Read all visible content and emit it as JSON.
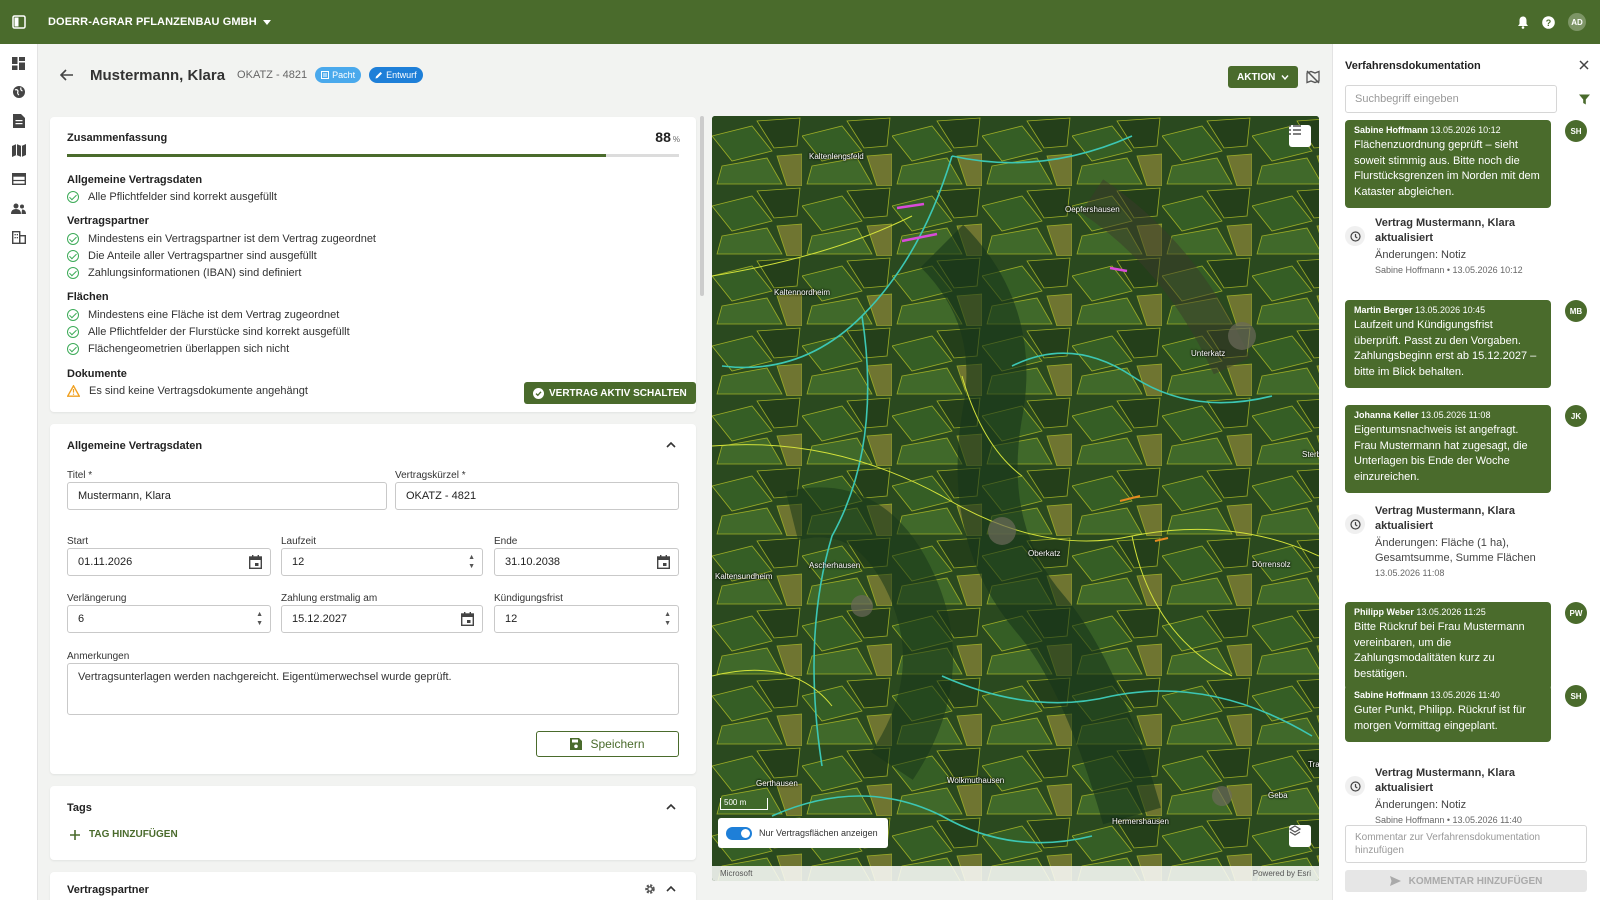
{
  "topbar": {
    "company": "DOERR-AGRAR PFLANZENBAU GMBH",
    "user_initials": "AD"
  },
  "header": {
    "title": "Mustermann, Klara",
    "code": "OKATZ - 4821",
    "chip_pacht": "Pacht",
    "chip_entwurf": "Entwurf",
    "action_label": "AKTION"
  },
  "summary": {
    "title": "Zusammenfassung",
    "percent": "88",
    "percent_unit": "%",
    "progress_value": 0.88,
    "sections": [
      {
        "title": "Allgemeine Vertragsdaten",
        "items": [
          "Alle Pflichtfelder sind korrekt ausgefüllt"
        ]
      },
      {
        "title": "Vertragspartner",
        "items": [
          "Mindestens ein Vertragspartner ist dem Vertrag zugeordnet",
          "Die Anteile aller Vertragspartner sind ausgefüllt",
          "Zahlungsinformationen (IBAN) sind definiert"
        ]
      },
      {
        "title": "Flächen",
        "items": [
          "Mindestens eine Fläche ist dem Vertrag zugeordnet",
          "Alle Pflichtfelder der Flurstücke sind korrekt ausgefüllt",
          "Flächengeometrien überlappen sich nicht"
        ]
      },
      {
        "title": "Dokumente",
        "items": [
          "Es sind keine Vertragsdokumente angehängt"
        ]
      }
    ],
    "activate_label": "VERTRAG AKTIV SCHALTEN"
  },
  "form": {
    "title": "Allgemeine Vertragsdaten",
    "titel_label": "Titel *",
    "titel_value": "Mustermann, Klara",
    "kuerzel_label": "Vertragskürzel *",
    "kuerzel_value": "OKATZ - 4821",
    "start_label": "Start",
    "start_value": "01.11.2026",
    "laufzeit_label": "Laufzeit",
    "laufzeit_value": "12",
    "ende_label": "Ende",
    "ende_value": "31.10.2038",
    "verl_label": "Verlängerung",
    "verl_value": "6",
    "zahlung_label": "Zahlung erstmalig am",
    "zahlung_value": "15.12.2027",
    "kuend_label": "Kündigungsfrist",
    "kuend_value": "12",
    "anm_label": "Anmerkungen",
    "anm_value": "Vertragsunterlagen werden nachgereicht. Eigentümerwechsel wurde geprüft.",
    "save_label": "Speichern"
  },
  "tags": {
    "title": "Tags",
    "add_label": "TAG HINZUFÜGEN"
  },
  "partner": {
    "title": "Vertragspartner"
  },
  "map": {
    "places": [
      "Kaltenlengsfeld",
      "Oepfershausen",
      "Kaltennordheim",
      "Unterkatz",
      "Sterb",
      "Oberkatz",
      "Dörrensolz",
      "Ascherhausen",
      "Kaltensundheim",
      "Gerthausen",
      "Wolkmuthausen",
      "Geba",
      "Hermershausen",
      "Tra"
    ],
    "scale": "500 m",
    "toggle_label": "Nur Vertragsflächen anzeigen",
    "credit_left": "Microsoft",
    "credit_right": "Powered by Esri"
  },
  "panel": {
    "title": "Verfahrensdokumentation",
    "search_placeholder": "Suchbegriff eingeben",
    "messages": [
      {
        "author": "Sabine Hoffmann",
        "time": "13.05.2026 10:12",
        "text": "Flächenzuordnung geprüft – sieht soweit stimmig aus. Bitte noch die Flurstücksgrenzen im Norden mit dem Kataster abgleichen.",
        "initials": "SH"
      },
      {
        "author": "Martin Berger",
        "time": "13.05.2026 10:45",
        "text": "Laufzeit und Kündigungsfrist überprüft. Passt zu den Vorgaben. Zahlungsbeginn erst ab 15.12.2027 – bitte im Blick behalten.",
        "initials": "MB"
      },
      {
        "author": "Johanna Keller",
        "time": "13.05.2026 11:08",
        "text": "Eigentumsnachweis ist angefragt. Frau Mustermann hat zugesagt, die Unterlagen bis Ende der Woche einzureichen.",
        "initials": "JK"
      },
      {
        "author": "Philipp Weber",
        "time": "13.05.2026 11:25",
        "text": "Bitte Rückruf bei Frau Mustermann vereinbaren, um die Zahlungsmodalitäten kurz zu bestätigen.",
        "initials": "PW"
      },
      {
        "author": "Sabine Hoffmann",
        "time": "13.05.2026 11:40",
        "text": "Guter Punkt, Philipp. Rückruf ist für morgen Vormittag eingeplant.",
        "initials": "SH"
      }
    ],
    "history": [
      {
        "title": "Vertrag Mustermann, Klara aktualisiert",
        "change": "Änderungen: Notiz",
        "meta": "Sabine Hoffmann • 13.05.2026 10:12"
      },
      {
        "title": "Vertrag Mustermann, Klara aktualisiert",
        "change": "Änderungen: Fläche (1 ha), Gesamtsumme, Summe Flächen",
        "meta": "13.05.2026 11:08"
      },
      {
        "title": "Vertrag Mustermann, Klara aktualisiert",
        "change": "Änderungen: Notiz",
        "meta": "Sabine Hoffmann • 13.05.2026 11:40"
      }
    ],
    "comment_placeholder": "Kommentar zur Verfahrensdokumentation hinzufügen",
    "comment_button": "KOMMENTAR HINZUFÜGEN"
  }
}
